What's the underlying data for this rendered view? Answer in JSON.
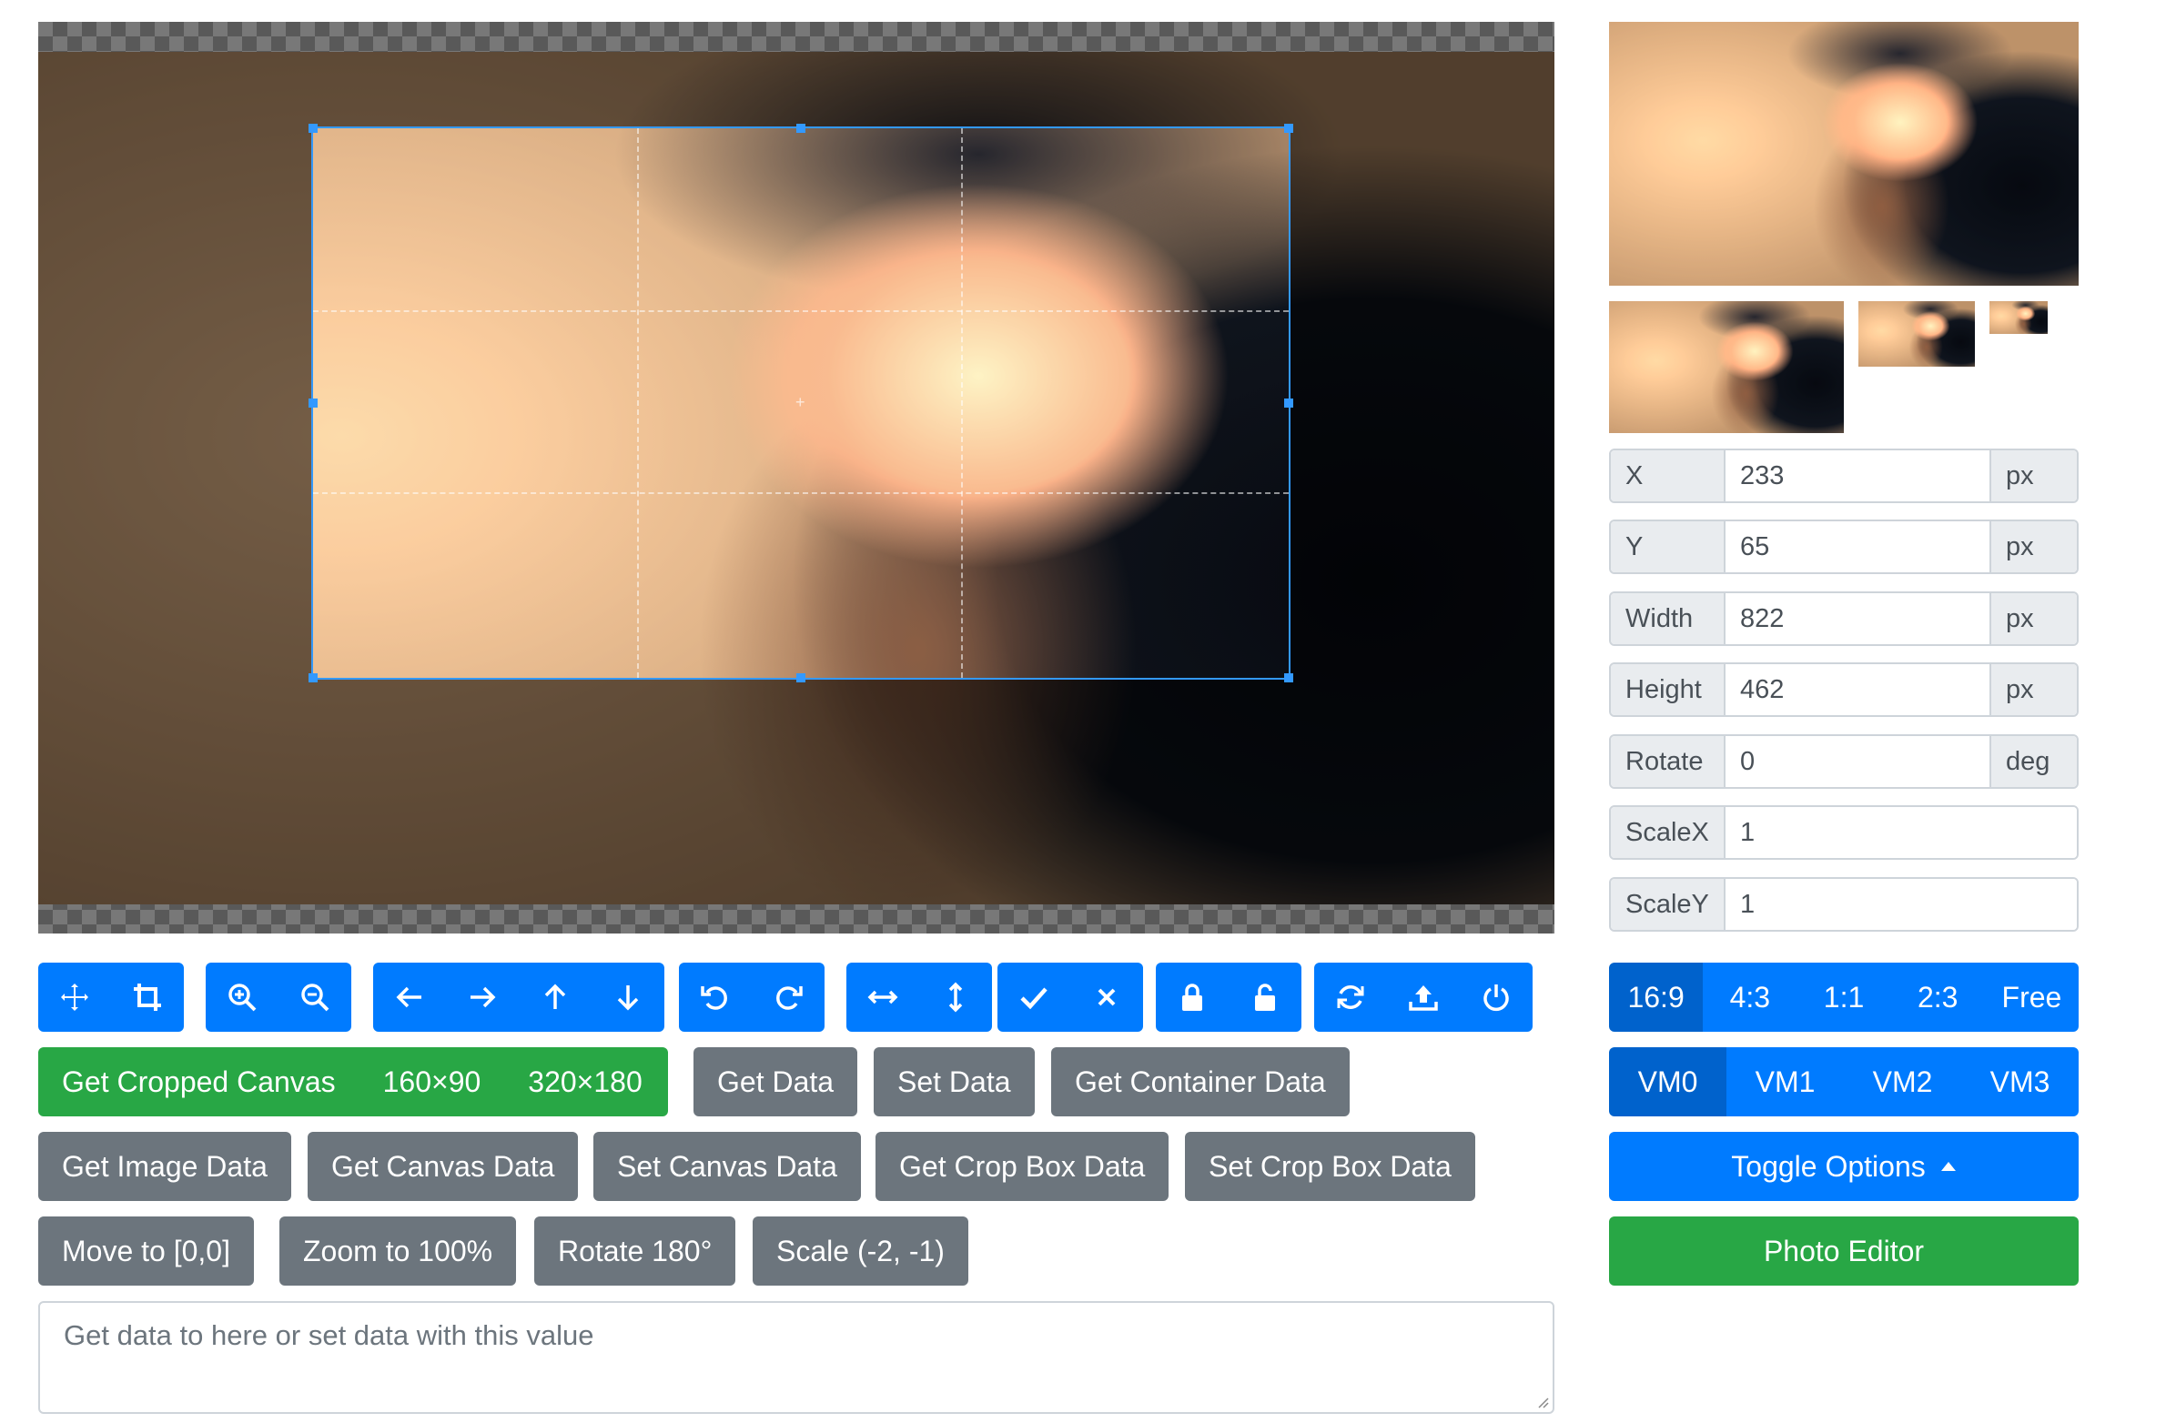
{
  "toolbar": {
    "groups": [
      [
        {
          "name": "move-icon",
          "label": "Move"
        },
        {
          "name": "crop-icon",
          "label": "Crop"
        }
      ],
      [
        {
          "name": "zoom-in-icon",
          "label": "Zoom In"
        },
        {
          "name": "zoom-out-icon",
          "label": "Zoom Out"
        }
      ],
      [
        {
          "name": "arrow-left-icon"
        },
        {
          "name": "arrow-right-icon"
        },
        {
          "name": "arrow-up-icon"
        },
        {
          "name": "arrow-down-icon"
        }
      ],
      [
        {
          "name": "rotate-left-icon"
        },
        {
          "name": "rotate-right-icon"
        }
      ],
      [
        {
          "name": "flip-horizontal-icon"
        },
        {
          "name": "flip-vertical-icon"
        }
      ],
      [
        {
          "name": "check-icon"
        },
        {
          "name": "close-icon"
        }
      ],
      [
        {
          "name": "lock-icon"
        },
        {
          "name": "unlock-icon"
        }
      ],
      [
        {
          "name": "reset-icon"
        },
        {
          "name": "upload-icon"
        },
        {
          "name": "power-icon"
        }
      ]
    ]
  },
  "actions": {
    "get_cropped_canvas": "Get Cropped Canvas",
    "size_160": "160×90",
    "size_320": "320×180",
    "get_data": "Get Data",
    "set_data": "Set Data",
    "get_container_data": "Get Container Data",
    "get_image_data": "Get Image Data",
    "get_canvas_data": "Get Canvas Data",
    "set_canvas_data": "Set Canvas Data",
    "get_crop_box_data": "Get Crop Box Data",
    "set_crop_box_data": "Set Crop Box Data",
    "move_to": "Move to [0,0]",
    "zoom_to": "Zoom to 100%",
    "rotate_180": "Rotate 180°",
    "scale": "Scale (-2, -1)"
  },
  "textarea": {
    "placeholder": "Get data to here or set data with this value"
  },
  "data_fields": {
    "x": {
      "label": "X",
      "value": "233",
      "unit": "px"
    },
    "y": {
      "label": "Y",
      "value": "65",
      "unit": "px"
    },
    "width": {
      "label": "Width",
      "value": "822",
      "unit": "px"
    },
    "height": {
      "label": "Height",
      "value": "462",
      "unit": "px"
    },
    "rotate": {
      "label": "Rotate",
      "value": "0",
      "unit": "deg"
    },
    "scaleX": {
      "label": "ScaleX",
      "value": "1"
    },
    "scaleY": {
      "label": "ScaleY",
      "value": "1"
    }
  },
  "aspect_ratios": [
    "16:9",
    "4:3",
    "1:1",
    "2:3",
    "Free"
  ],
  "aspect_selected": "16:9",
  "view_modes": [
    "VM0",
    "VM1",
    "VM2",
    "VM3"
  ],
  "view_mode_selected": "VM0",
  "toggle_options": "Toggle Options",
  "photo_editor": "Photo Editor",
  "colors": {
    "primary": "#007bff",
    "primary_active": "#0062cc",
    "success": "#28a745",
    "secondary": "#6c757d",
    "crop_border": "#3399ff"
  }
}
